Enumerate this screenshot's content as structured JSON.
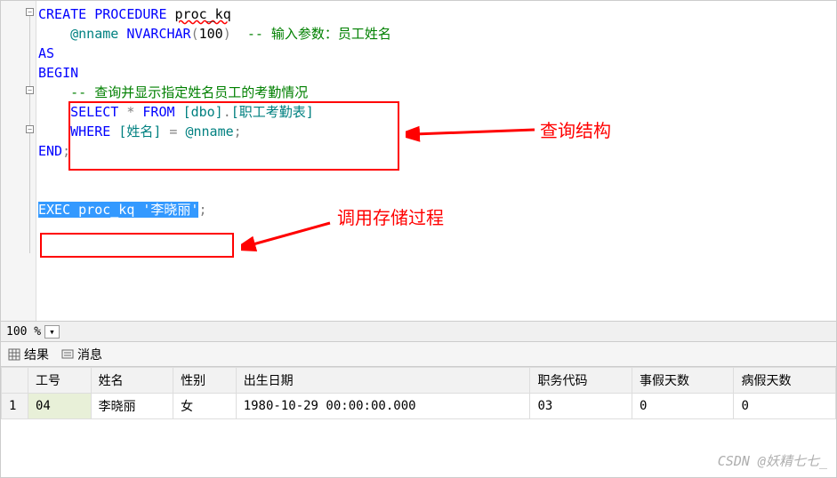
{
  "code": {
    "l1_kw1": "CREATE",
    "l1_kw2": "PROCEDURE",
    "l1_name": "proc_kq",
    "l2_param": "@nname",
    "l2_type": "NVARCHAR",
    "l2_size": "100",
    "l2_comment": "-- 输入参数：员工姓名",
    "l3": "AS",
    "l4": "BEGIN",
    "l5_comment": "-- 查询并显示指定姓名员工的考勤情况",
    "l6_kw1": "SELECT",
    "l6_star": "*",
    "l6_kw2": "FROM",
    "l6_schema": "[dbo]",
    "l6_dot": ".",
    "l6_table": "[职工考勤表]",
    "l7_kw": "WHERE",
    "l7_col": "[姓名]",
    "l7_eq": "=",
    "l7_param": "@nname",
    "l8": "END",
    "l10_kw": "EXEC",
    "l10_proc": "proc_kq",
    "l10_arg": "'李晓丽'"
  },
  "annotations": {
    "a1": "查询结构",
    "a2": "调用存储过程"
  },
  "zoom": "100 %",
  "tabs": {
    "results": "结果",
    "messages": "消息"
  },
  "grid": {
    "headers": [
      "",
      "工号",
      "姓名",
      "性别",
      "出生日期",
      "职务代码",
      "事假天数",
      "病假天数"
    ],
    "row_num": "1",
    "row": [
      "04",
      "李晓丽",
      "女",
      "1980-10-29 00:00:00.000",
      "03",
      "0",
      "0"
    ]
  },
  "watermark": "CSDN @妖精七七_"
}
